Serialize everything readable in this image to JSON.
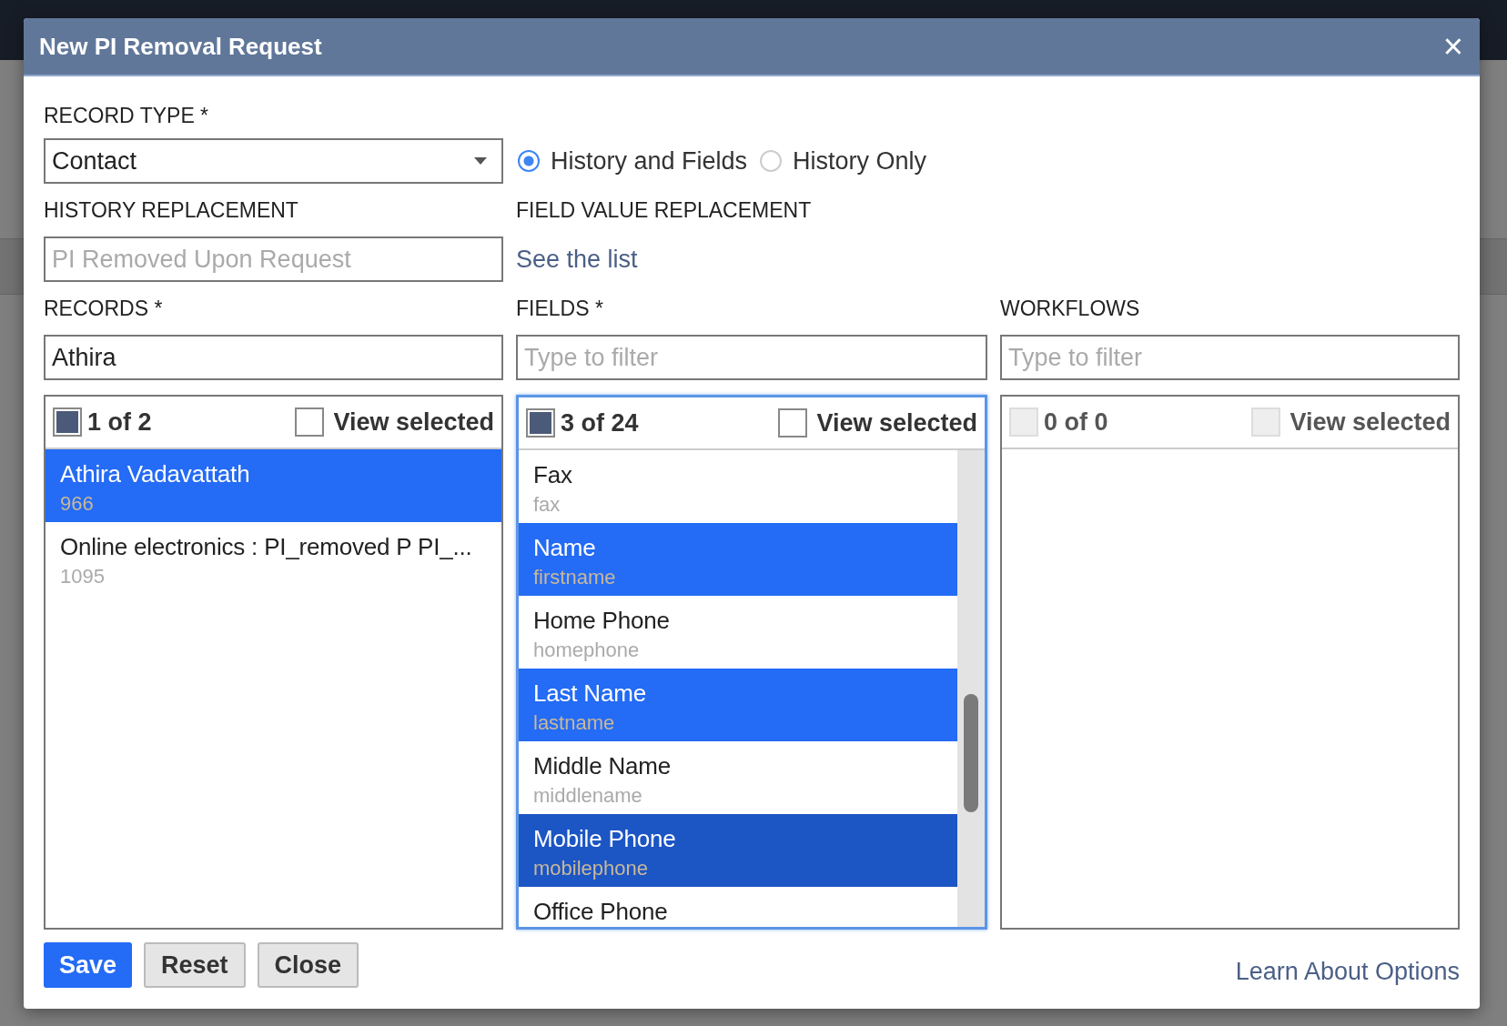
{
  "dialog": {
    "title": "New PI Removal Request",
    "close_icon": "×"
  },
  "record_type": {
    "label": "RECORD TYPE *",
    "value": "Contact"
  },
  "mode_options": [
    {
      "label": "History and Fields",
      "selected": true
    },
    {
      "label": "History Only",
      "selected": false
    }
  ],
  "history_replacement": {
    "label": "HISTORY REPLACEMENT",
    "placeholder": "PI Removed Upon Request"
  },
  "field_value_replacement": {
    "label": "FIELD VALUE REPLACEMENT",
    "link": "See the list"
  },
  "lists": [
    {
      "label": "RECORDS *",
      "filter_value": "Athira",
      "count": "1 of 2",
      "select_all_partial": true,
      "disabled": false,
      "focused": false,
      "view_selected": {
        "label": "View selected",
        "checked": false
      },
      "scrollbar": false,
      "items": [
        {
          "title": "Athira Vadavattath",
          "subtitle": "966",
          "selected": true,
          "hovered": false
        },
        {
          "title": "Online electronics : PI_removed P PI_...",
          "subtitle": "1095",
          "selected": false,
          "hovered": false
        }
      ]
    },
    {
      "label": "FIELDS *",
      "filter_placeholder": "Type to filter",
      "count": "3 of 24",
      "select_all_partial": true,
      "disabled": false,
      "focused": true,
      "view_selected": {
        "label": "View selected",
        "checked": false
      },
      "scrollbar": true,
      "items": [
        {
          "title": "Fax",
          "subtitle": "fax",
          "selected": false,
          "hovered": false
        },
        {
          "title": "Name",
          "subtitle": "firstname",
          "selected": true,
          "hovered": false
        },
        {
          "title": "Home Phone",
          "subtitle": "homephone",
          "selected": false,
          "hovered": false
        },
        {
          "title": "Last Name",
          "subtitle": "lastname",
          "selected": true,
          "hovered": false
        },
        {
          "title": "Middle Name",
          "subtitle": "middlename",
          "selected": false,
          "hovered": false
        },
        {
          "title": "Mobile Phone",
          "subtitle": "mobilephone",
          "selected": true,
          "hovered": true
        },
        {
          "title": "Office Phone",
          "selected": false,
          "hovered": false
        }
      ]
    },
    {
      "label": "WORKFLOWS",
      "filter_placeholder": "Type to filter",
      "count": "0 of 0",
      "select_all_partial": false,
      "disabled": true,
      "focused": false,
      "view_selected": {
        "label": "View selected",
        "checked": false
      },
      "scrollbar": false
    }
  ],
  "buttons": [
    {
      "label": "Save",
      "kind": "primary"
    },
    {
      "label": "Reset",
      "kind": "secondary"
    },
    {
      "label": "Close",
      "kind": "secondary"
    }
  ],
  "help_link": "Learn About Options"
}
